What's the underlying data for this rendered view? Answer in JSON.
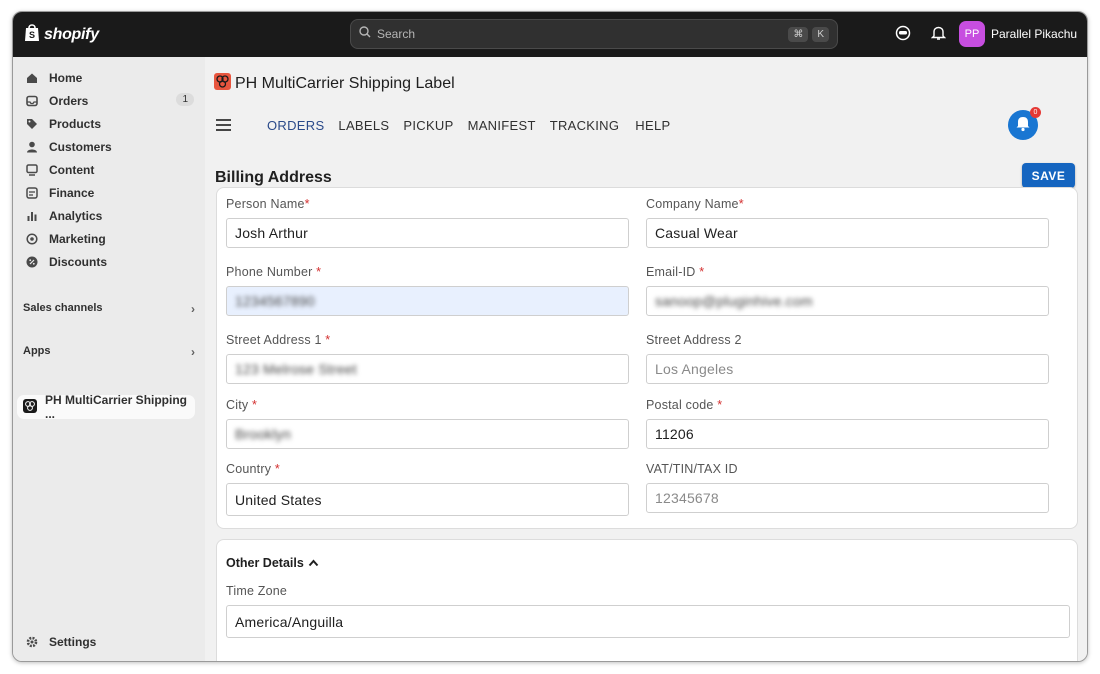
{
  "topbar": {
    "brand": "shopify",
    "search_placeholder": "Search",
    "shortcut_key1": "⌘",
    "shortcut_key2": "K",
    "user_initials": "PP",
    "user_name": "Parallel Pikachu",
    "avatar_color": "#c74ee0"
  },
  "sidebar": {
    "items": [
      {
        "label": "Home",
        "icon": "home-icon"
      },
      {
        "label": "Orders",
        "icon": "orders-icon",
        "badge": "1"
      },
      {
        "label": "Products",
        "icon": "tag-icon"
      },
      {
        "label": "Customers",
        "icon": "person-icon"
      },
      {
        "label": "Content",
        "icon": "content-icon"
      },
      {
        "label": "Finance",
        "icon": "bank-icon"
      },
      {
        "label": "Analytics",
        "icon": "bar-chart-icon"
      },
      {
        "label": "Marketing",
        "icon": "target-icon"
      },
      {
        "label": "Discounts",
        "icon": "discount-icon"
      }
    ],
    "sales_channels": "Sales channels",
    "apps": "Apps",
    "app_item": "PH MultiCarrier Shipping ...",
    "settings": "Settings"
  },
  "app": {
    "title": "PH MultiCarrier Shipping Label",
    "tabs": [
      "ORDERS",
      "LABELS",
      "PICKUP",
      "MANIFEST",
      "TRACKING",
      "HELP"
    ],
    "active_tab": "ORDERS",
    "notification_count": "0",
    "section_title": "Billing Address",
    "save_label": "SAVE",
    "accent_color": "#1565c0"
  },
  "form": {
    "person_name": {
      "label": "Person Name",
      "value": "Josh Arthur"
    },
    "company_name": {
      "label": "Company Name",
      "value": "Casual Wear"
    },
    "phone_number": {
      "label": "Phone Number ",
      "value": "1234567890"
    },
    "email_id": {
      "label": "Email-ID ",
      "value": "sanoop@pluginhive.com"
    },
    "street1": {
      "label": "Street Address 1 ",
      "value": "123 Melrose Street"
    },
    "street2": {
      "label": "Street Address 2",
      "value": "Los Angeles"
    },
    "city": {
      "label": "City ",
      "value": "Brooklyn"
    },
    "postal_code": {
      "label": "Postal code ",
      "value": "11206"
    },
    "country": {
      "label": "Country ",
      "value": "United States"
    },
    "tax_id": {
      "label": "VAT/TIN/TAX ID",
      "placeholder": "12345678"
    },
    "required_mark": "*"
  },
  "other": {
    "title": "Other Details",
    "time_zone_label": "Time Zone",
    "time_zone_value": "America/Anguilla"
  }
}
